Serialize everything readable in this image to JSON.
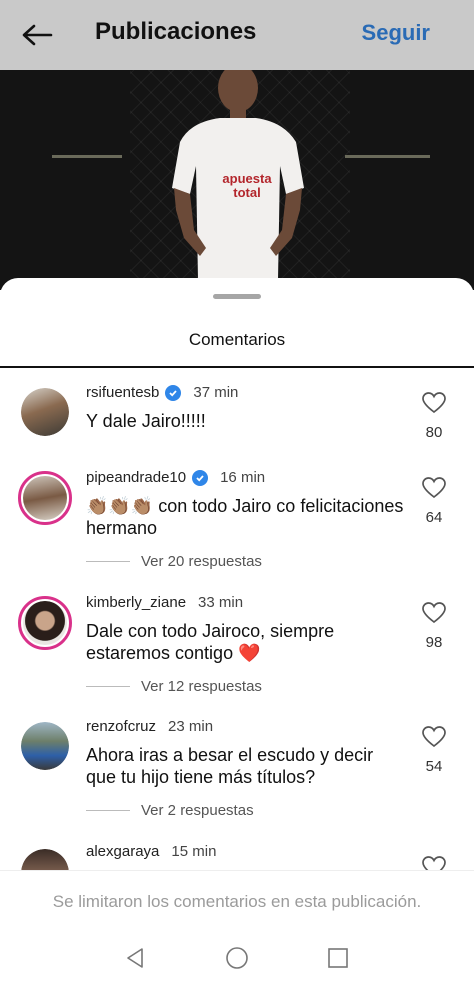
{
  "header": {
    "title": "Publicaciones",
    "follow_label": "Seguir"
  },
  "sheet": {
    "title": "Comentarios"
  },
  "comments": [
    {
      "username": "rsifuentesb",
      "verified": true,
      "time": "37 min",
      "text": "Y dale Jairo!!!!!",
      "likes": "80",
      "replies": ""
    },
    {
      "username": "pipeandrade10",
      "verified": true,
      "time": "16 min",
      "text": "👏🏽👏🏽👏🏽 con todo Jairo co felicitaciones hermano",
      "likes": "64",
      "replies": "Ver 20 respuestas"
    },
    {
      "username": "kimberly_ziane",
      "verified": false,
      "time": "33 min",
      "text": "Dale con todo Jairoco, siempre estaremos contigo ❤️",
      "likes": "98",
      "replies": "Ver 12 respuestas"
    },
    {
      "username": "renzofcruz",
      "verified": false,
      "time": "23 min",
      "text": "Ahora iras a besar el escudo y decir que tu hijo tiene más títulos?",
      "likes": "54",
      "replies": "Ver 2 respuestas"
    },
    {
      "username": "alexgaraya",
      "verified": false,
      "time": "15 min",
      "text": "",
      "likes": "",
      "replies": ""
    }
  ],
  "footer": {
    "limit_notice": "Se limitaron los comentarios en esta publicación."
  },
  "photo": {
    "jersey_brand": "apuesta total"
  },
  "colors": {
    "accent": "#2a6bb5",
    "story_ring": "#d9318a",
    "verified": "#2f86e8"
  }
}
